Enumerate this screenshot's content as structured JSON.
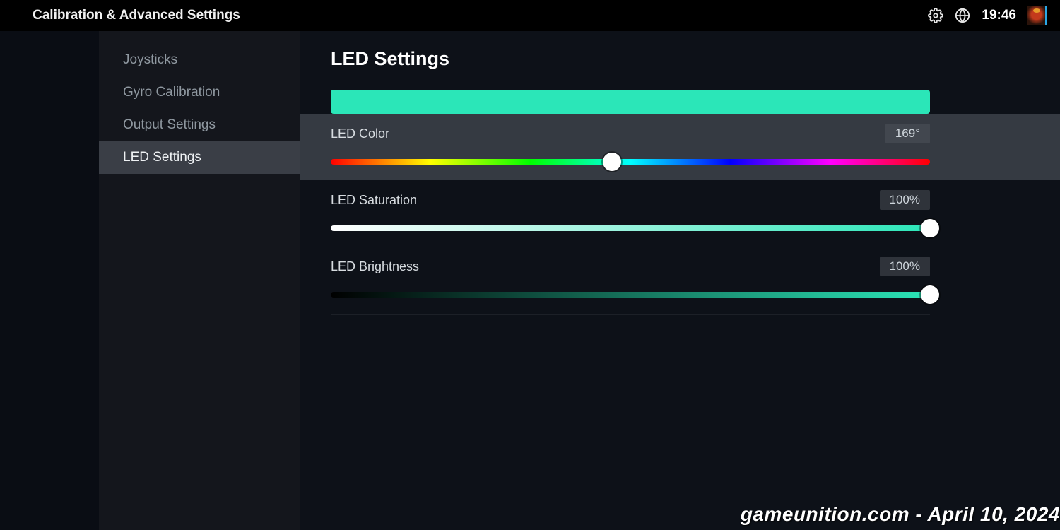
{
  "header": {
    "title": "Calibration & Advanced Settings",
    "time": "19:46"
  },
  "sidebar": {
    "items": [
      {
        "label": "Joysticks"
      },
      {
        "label": "Gyro Calibration"
      },
      {
        "label": "Output Settings"
      },
      {
        "label": "LED Settings"
      }
    ],
    "active_index": 3
  },
  "page": {
    "title": "LED Settings",
    "preview_color": "#2be6b8",
    "led_color": {
      "label": "LED Color",
      "value_display": "169°",
      "hue_deg": 169
    },
    "led_saturation": {
      "label": "LED Saturation",
      "value_display": "100%",
      "percent": 100
    },
    "led_brightness": {
      "label": "LED Brightness",
      "value_display": "100%",
      "percent": 100
    }
  },
  "watermark": "gameunition.com - April 10, 2024"
}
